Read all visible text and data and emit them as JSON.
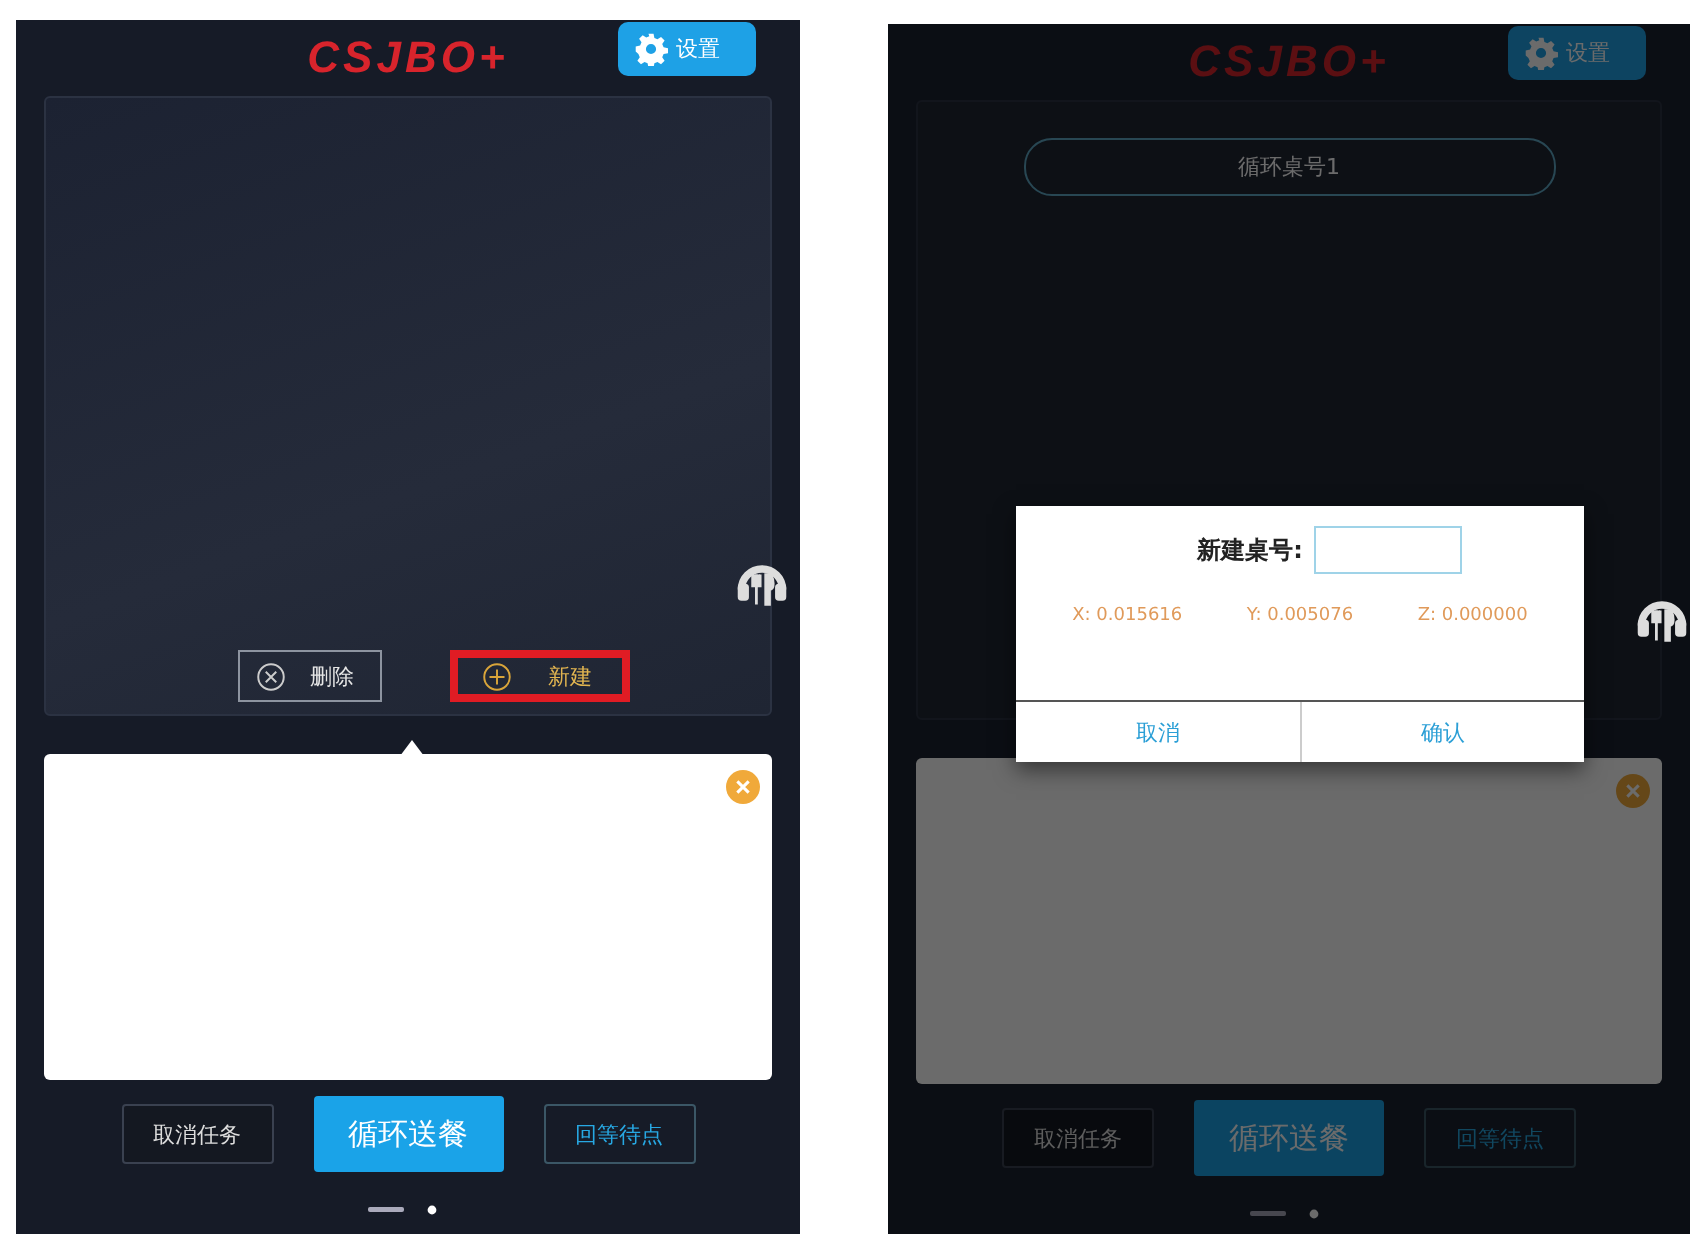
{
  "screens": [
    {
      "logo": "CSJBO+",
      "settings_button": "设置",
      "dimmed": false,
      "actions": [
        {
          "kind": "delete",
          "label": "删除",
          "highlighted": false
        },
        {
          "kind": "new",
          "label": "新建",
          "highlighted": true
        }
      ],
      "bottom_buttons": [
        {
          "kind": "outline",
          "label": "取消任务"
        },
        {
          "kind": "primary",
          "label": "循环送餐"
        },
        {
          "kind": "outline-blue",
          "label": "回等待点"
        }
      ]
    },
    {
      "logo": "CSJBO+",
      "settings_button": "设置",
      "dimmed": true,
      "table_selector": "循环桌号1",
      "bottom_buttons": [
        {
          "kind": "outline",
          "label": "取消任务"
        },
        {
          "kind": "primary",
          "label": "循环送餐"
        },
        {
          "kind": "outline-blue",
          "label": "回等待点"
        }
      ],
      "dialog": {
        "label": "新建桌号:",
        "coordinates": [
          "X: 0.015616",
          "Y: 0.005076",
          "Z: 0.000000"
        ],
        "buttons": [
          "取消",
          "确认"
        ]
      }
    }
  ]
}
